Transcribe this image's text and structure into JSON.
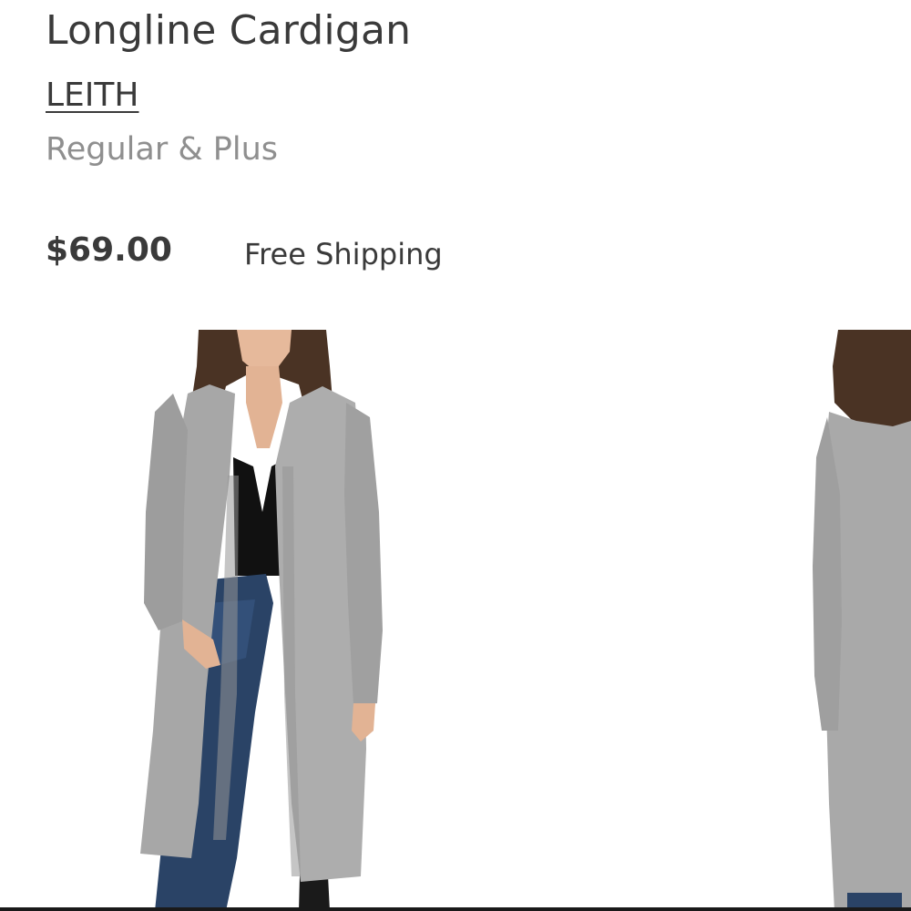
{
  "product": {
    "title": "Longline Cardigan",
    "brand": "LEITH",
    "sizes": "Regular & Plus",
    "price": "$69.00",
    "shipping": "Free Shipping"
  },
  "gallery": {
    "images": [
      {
        "name": "front-view",
        "garment_color": "#a9a9a9"
      },
      {
        "name": "back-view",
        "garment_color": "#a9a9a9"
      }
    ]
  },
  "colors": {
    "text": "#3a3a3a",
    "muted": "#8f8f8f",
    "background": "#ffffff"
  }
}
